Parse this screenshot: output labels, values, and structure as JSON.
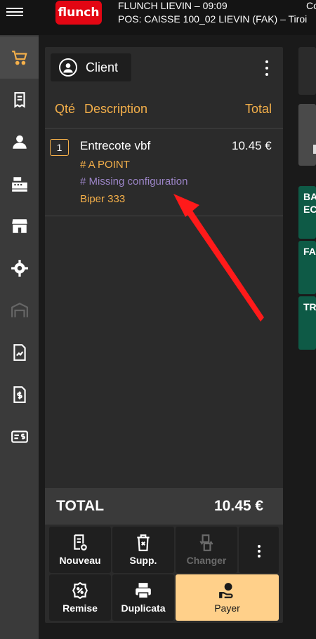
{
  "header": {
    "store_line": "FLUNCH LIEVIN – 09:09",
    "pos_line": "POS: CAISSE 100_02 LIEVIN (FAK) – Tiroi",
    "right_fragment": "Co",
    "logo_text": "flunch"
  },
  "rail": {
    "items": [
      "cart-icon",
      "receipt-icon",
      "user-icon",
      "cash-register-icon",
      "store-icon",
      "settings-icon",
      "warehouse-icon",
      "report-icon",
      "invoice-dollar-icon",
      "payment-card-icon"
    ],
    "active_index": 0
  },
  "order": {
    "client_label": "Client",
    "columns": {
      "qty": "Qté",
      "description": "Description",
      "total": "Total"
    },
    "item": {
      "qty": "1",
      "name": "Entrecote vbf",
      "price": "10.45 €",
      "modifier1": "# A POINT",
      "modifier2": "# Missing configuration",
      "modifier3": "Biper 333"
    },
    "total_label": "TOTAL",
    "total_value": "10.45 €"
  },
  "actions": {
    "nouveau": "Nouveau",
    "supp": "Supp.",
    "changer": "Changer",
    "remise": "Remise",
    "duplicata": "Duplicata",
    "payer": "Payer"
  },
  "right_column": {
    "btn1_line1": "BA",
    "btn1_line2": "EC",
    "btn2": "FA",
    "btn3": "TR"
  },
  "colors": {
    "accent": "#f5b04a",
    "missing_config": "#9b84c6",
    "pay_button": "#ffd08a",
    "green_tile": "#0e5a46",
    "brand_red": "#e30613",
    "annotation_arrow": "#ff1a1a"
  }
}
